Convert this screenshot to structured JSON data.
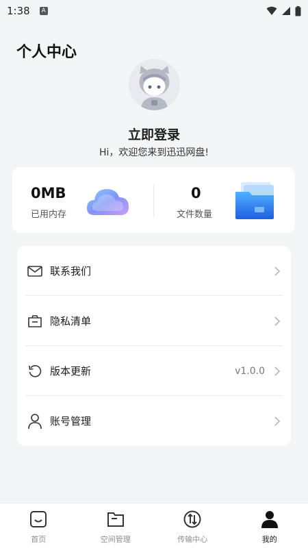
{
  "status_bar": {
    "time": "1:38",
    "notification_badge": "A",
    "icons": [
      "wifi-icon",
      "signal-icon",
      "battery-icon"
    ]
  },
  "page": {
    "title": "个人中心"
  },
  "profile": {
    "avatar_icon": "avatar-icon",
    "login_text": "立即登录",
    "welcome_text": "Hi，欢迎您来到迅迅网盘!"
  },
  "stats": {
    "storage": {
      "value": "0MB",
      "label": "已用内存",
      "icon": "cloud-icon"
    },
    "files": {
      "value": "0",
      "label": "文件数量",
      "icon": "folder-icon"
    }
  },
  "menu": {
    "items": [
      {
        "label": "联系我们",
        "icon": "mail-icon",
        "value": ""
      },
      {
        "label": "隐私清单",
        "icon": "privacy-list-icon",
        "value": ""
      },
      {
        "label": "版本更新",
        "icon": "refresh-icon",
        "value": "v1.0.0"
      },
      {
        "label": "账号管理",
        "icon": "user-icon",
        "value": ""
      }
    ]
  },
  "bottom_nav": {
    "active_index": 3,
    "items": [
      {
        "label": "首页",
        "icon": "home-icon"
      },
      {
        "label": "空间管理",
        "icon": "folder-manage-icon"
      },
      {
        "label": "传输中心",
        "icon": "transfer-icon"
      },
      {
        "label": "我的",
        "icon": "profile-icon"
      }
    ]
  },
  "colors": {
    "background": "#f4f5f7",
    "card": "#ffffff",
    "text_primary": "#1c1c1e",
    "text_secondary": "#8e8e93",
    "accent_blue": "#3a8ef6"
  }
}
